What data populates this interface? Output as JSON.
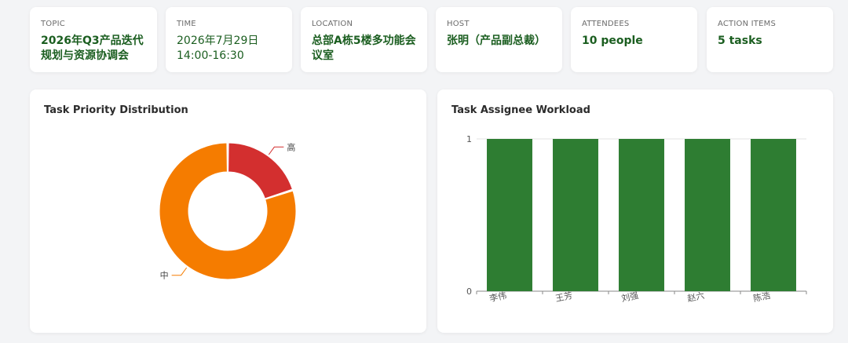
{
  "info_cards": [
    {
      "label": "TOPIC",
      "value": "2026年Q3产品迭代规划与资源协调会"
    },
    {
      "label": "TIME",
      "value": "2026年7月29日 14:00-16:30"
    },
    {
      "label": "LOCATION",
      "value": "总部A栋5楼多功能会议室"
    },
    {
      "label": "HOST",
      "value": "张明（产品副总裁）"
    },
    {
      "label": "ATTENDEES",
      "value": "10 people"
    },
    {
      "label": "ACTION ITEMS",
      "value": "5 tasks"
    }
  ],
  "colors": {
    "high": "#d32f2f",
    "medium": "#f57c00",
    "bar": "#2e7d32",
    "value_text": "#1b5e20"
  },
  "chart_data": [
    {
      "type": "pie",
      "title": "Task Priority Distribution",
      "donut": true,
      "slices": [
        {
          "label": "高",
          "value": 1,
          "color": "#d32f2f"
        },
        {
          "label": "中",
          "value": 4,
          "color": "#f57c00"
        }
      ]
    },
    {
      "type": "bar",
      "title": "Task Assignee Workload",
      "categories": [
        "李伟",
        "王芳",
        "刘强",
        "赵六",
        "陈浩"
      ],
      "values": [
        1,
        1,
        1,
        1,
        1
      ],
      "ylim": [
        0,
        1
      ],
      "yticks": [
        0,
        1
      ],
      "color": "#2e7d32",
      "grid": true
    }
  ]
}
